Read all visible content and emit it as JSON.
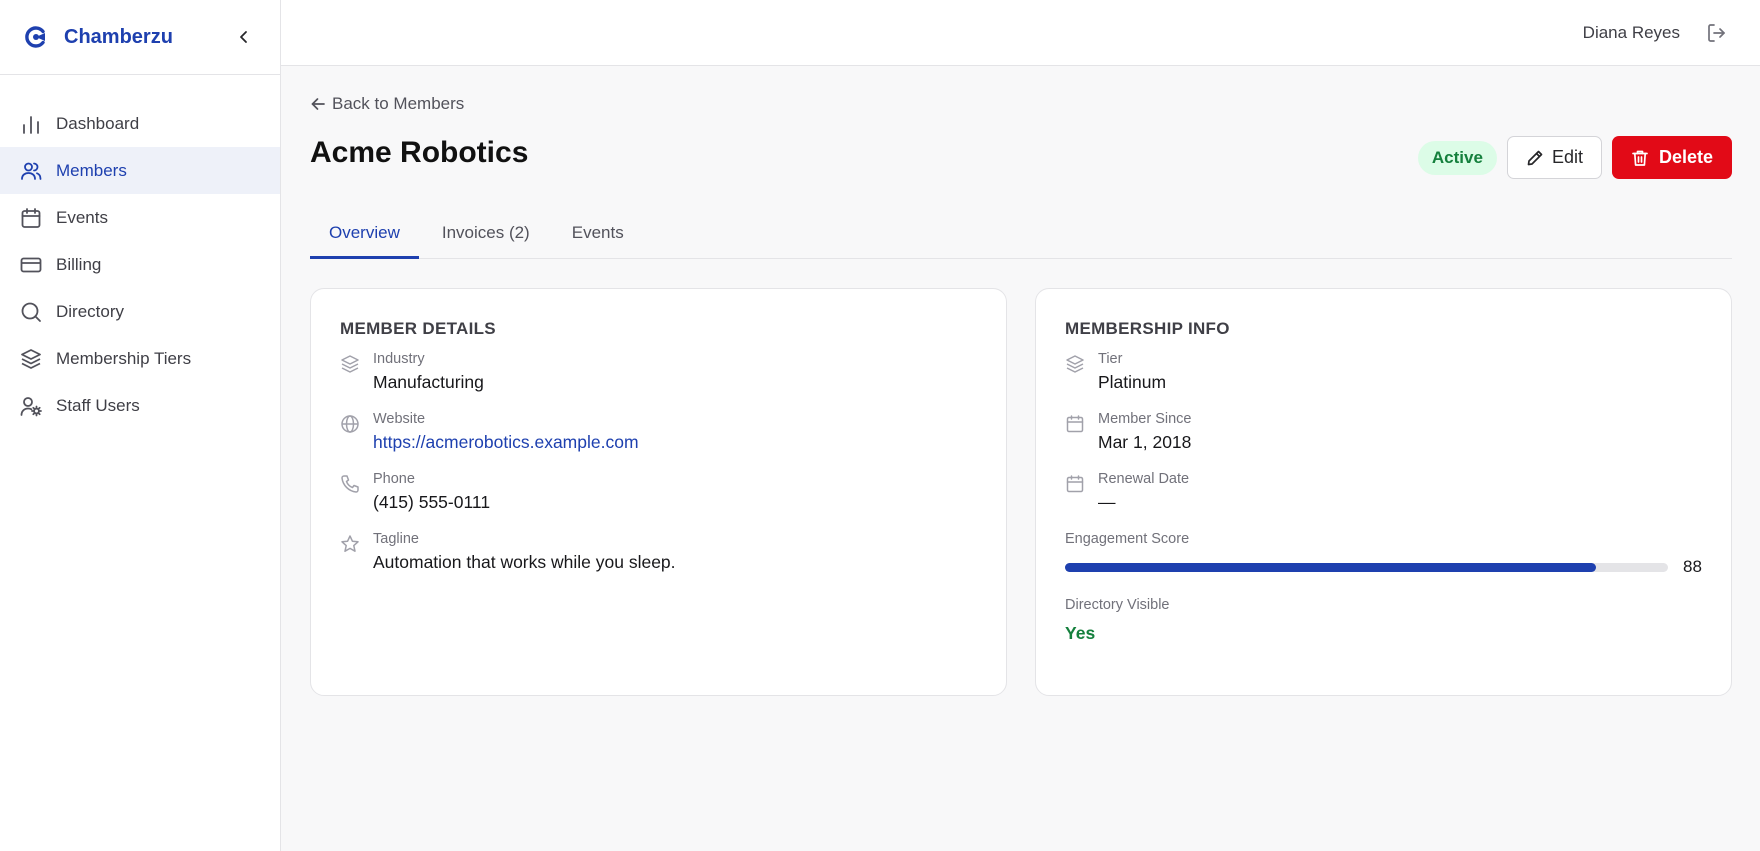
{
  "brand": {
    "name": "Chamberzu",
    "accent": "#1e40af"
  },
  "sidebar": {
    "items": [
      {
        "label": "Dashboard",
        "icon": "bar-chart-icon"
      },
      {
        "label": "Members",
        "icon": "users-icon",
        "active": true
      },
      {
        "label": "Events",
        "icon": "calendar-icon"
      },
      {
        "label": "Billing",
        "icon": "credit-card-icon"
      },
      {
        "label": "Directory",
        "icon": "search-icon"
      },
      {
        "label": "Membership Tiers",
        "icon": "layers-icon"
      },
      {
        "label": "Staff Users",
        "icon": "user-cog-icon"
      }
    ]
  },
  "topbar": {
    "user_name": "Diana Reyes",
    "logout_icon": "logout-icon"
  },
  "page": {
    "back_label": "Back to Members",
    "title": "Acme Robotics",
    "status": "Active",
    "edit_label": "Edit",
    "delete_label": "Delete",
    "status_color": "#15803d",
    "delete_color": "#e20a17"
  },
  "tabs": [
    {
      "label": "Overview",
      "active": true
    },
    {
      "label": "Invoices (2)"
    },
    {
      "label": "Events"
    }
  ],
  "member_details": {
    "title": "MEMBER DETAILS",
    "industry_label": "Industry",
    "industry": "Manufacturing",
    "website_label": "Website",
    "website": "https://acmerobotics.example.com",
    "phone_label": "Phone",
    "phone": "(415) 555-0111",
    "tagline_label": "Tagline",
    "tagline": "Automation that works while you sleep."
  },
  "membership_info": {
    "title": "MEMBERSHIP INFO",
    "tier_label": "Tier",
    "tier": "Platinum",
    "since_label": "Member Since",
    "since": "Mar 1, 2018",
    "renewal_label": "Renewal Date",
    "renewal": "—",
    "engagement_label": "Engagement Score",
    "engagement_score": "88",
    "engagement_fraction": 0.88,
    "directory_label": "Directory Visible",
    "directory_visible": "Yes"
  }
}
